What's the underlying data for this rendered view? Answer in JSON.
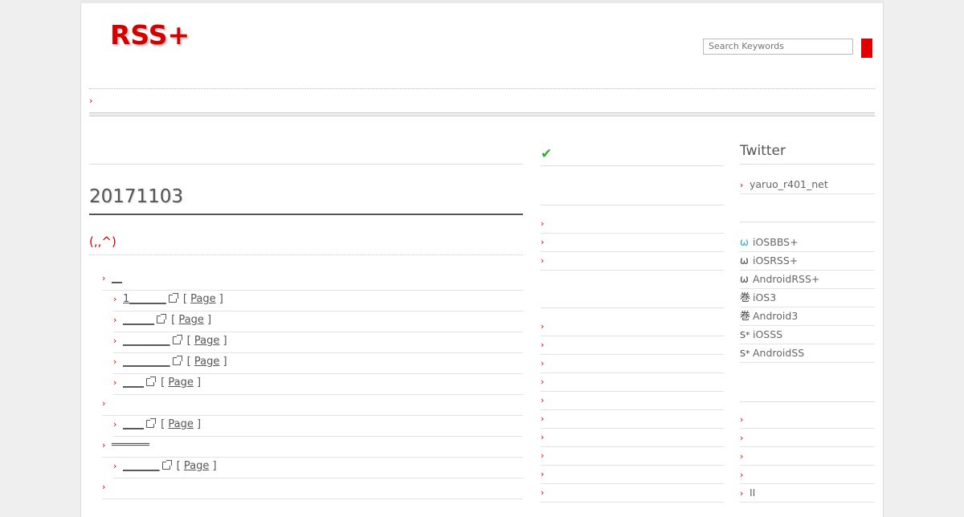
{
  "header": {
    "logo": "RSS+",
    "search_placeholder": "Search Keywords"
  },
  "main": {
    "date": "20171103",
    "face": "(,,^)",
    "rows": [
      {
        "level": 1,
        "text": "__",
        "has_link": false
      },
      {
        "level": 2,
        "text": "1_______",
        "page": "Page"
      },
      {
        "level": 2,
        "text": "______",
        "page": "Page"
      },
      {
        "level": 2,
        "text": "_________",
        "page": "Page"
      },
      {
        "level": 2,
        "text": "_________",
        "page": "Page"
      },
      {
        "level": 2,
        "text": "____",
        "page": "Page"
      },
      {
        "level": 1,
        "text": "",
        "has_link": false
      },
      {
        "level": 2,
        "text": "____",
        "page": "Page"
      },
      {
        "level": 1,
        "text": "══════",
        "has_link": false
      },
      {
        "level": 2,
        "text": "_______",
        "page": "Page"
      },
      {
        "level": 1,
        "text": "",
        "has_link": false
      }
    ],
    "bracket_open": "[",
    "bracket_close": "]"
  },
  "sidebar": {
    "twitter_title": "Twitter",
    "twitter_user": "yaruo_r401_net",
    "apps": [
      {
        "icon": "omega-icon",
        "glyph": "ω",
        "color": "#29a3d6",
        "label": "iOSBBS+"
      },
      {
        "icon": "omega-icon",
        "glyph": "ω",
        "color": "#333333",
        "label": "iOSRSS+"
      },
      {
        "icon": "omega-icon",
        "glyph": "ω",
        "color": "#333333",
        "label": "AndroidRSS+"
      },
      {
        "icon": "scroll-kanji-icon",
        "glyph": "巻",
        "color": "#333333",
        "label": "iOS3"
      },
      {
        "icon": "scroll-kanji-icon",
        "glyph": "巻",
        "color": "#333333",
        "label": "Android3"
      },
      {
        "icon": "s-star-icon",
        "glyph": "S*",
        "color": "#333333",
        "label": "iOSSS"
      },
      {
        "icon": "s-star-icon",
        "glyph": "S*",
        "color": "#333333",
        "label": "AndroidSS"
      }
    ],
    "bottom_last": "II"
  },
  "colors": {
    "accent": "#d40000",
    "check": "#33aa33"
  }
}
